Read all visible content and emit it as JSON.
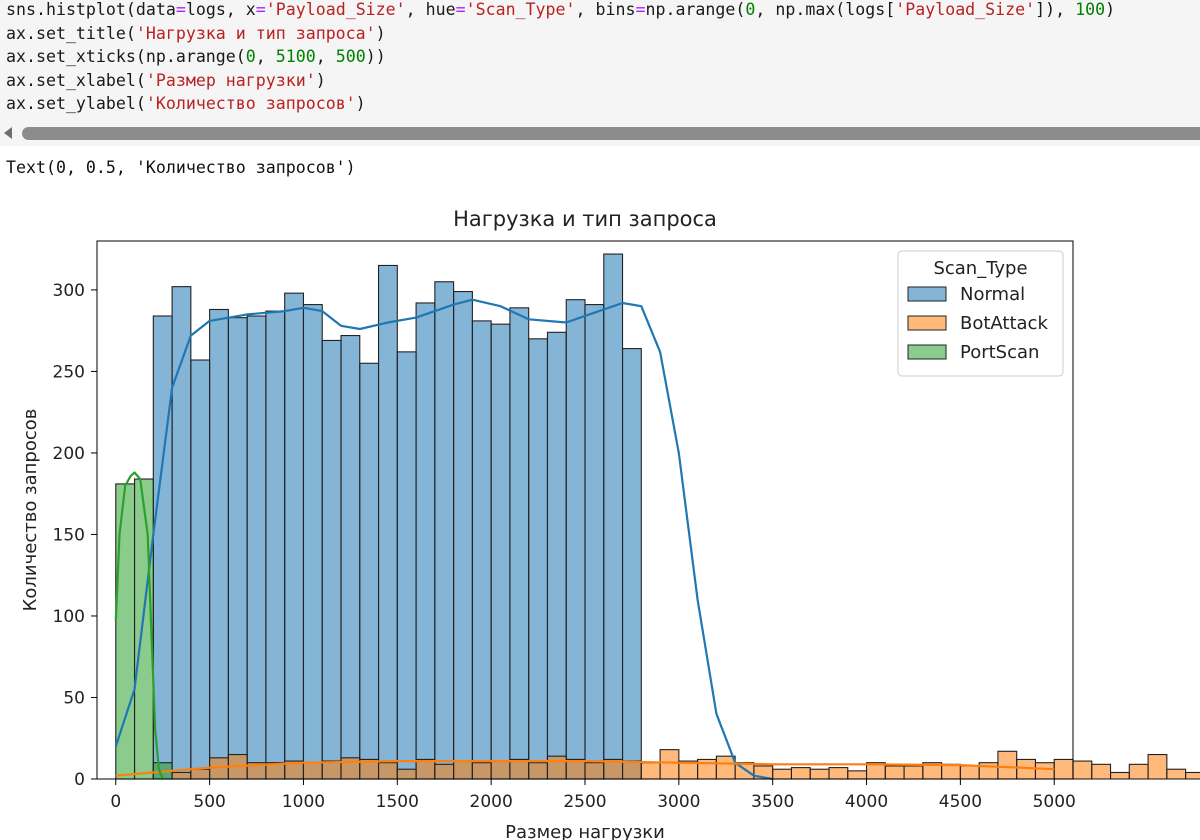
{
  "code_cell": {
    "lines": [
      [
        {
          "t": "sns.histplot(data"
        },
        {
          "t": "=",
          "c": "op"
        },
        {
          "t": "logs, x"
        },
        {
          "t": "=",
          "c": "op"
        },
        {
          "t": "'Payload_Size'",
          "c": "str"
        },
        {
          "t": ", hue"
        },
        {
          "t": "=",
          "c": "op"
        },
        {
          "t": "'Scan_Type'",
          "c": "str"
        },
        {
          "t": ", bins"
        },
        {
          "t": "=",
          "c": "op"
        },
        {
          "t": "np.arange("
        },
        {
          "t": "0",
          "c": "num"
        },
        {
          "t": ", np.max(logs["
        },
        {
          "t": "'Payload_Size'",
          "c": "str"
        },
        {
          "t": "]), "
        },
        {
          "t": "100",
          "c": "num"
        },
        {
          "t": ")"
        }
      ],
      [
        {
          "t": "ax.set_title("
        },
        {
          "t": "'Нагрузка и тип запроса'",
          "c": "str"
        },
        {
          "t": ")"
        }
      ],
      [
        {
          "t": "ax.set_xticks(np.arange("
        },
        {
          "t": "0",
          "c": "num"
        },
        {
          "t": ", "
        },
        {
          "t": "5100",
          "c": "num"
        },
        {
          "t": ", "
        },
        {
          "t": "500",
          "c": "num"
        },
        {
          "t": "))"
        }
      ],
      [
        {
          "t": "ax.set_xlabel("
        },
        {
          "t": "'Размер нагрузки'",
          "c": "str"
        },
        {
          "t": ")"
        }
      ],
      [
        {
          "t": "ax.set_ylabel("
        },
        {
          "t": "'Количество запросов'",
          "c": "str"
        },
        {
          "t": ")"
        }
      ]
    ]
  },
  "output": {
    "text": "Text(0, 0.5, 'Количество запросов')"
  },
  "chart_data": {
    "type": "bar",
    "title": "Нагрузка и тип запроса",
    "xlabel": "Размер нагрузки",
    "ylabel": "Количество запросов",
    "xlim": [
      -100,
      5100
    ],
    "ylim": [
      0,
      330
    ],
    "xticks": [
      0,
      500,
      1000,
      1500,
      2000,
      2500,
      3000,
      3500,
      4000,
      4500,
      5000
    ],
    "yticks": [
      0,
      50,
      100,
      150,
      200,
      250,
      300
    ],
    "bin_width": 100,
    "grid": false,
    "legend": {
      "title": "Scan_Type",
      "position": "top-right"
    },
    "series": [
      {
        "name": "Normal",
        "color": "#1f77b4",
        "bins_start": 200,
        "counts": [
          284,
          302,
          257,
          288,
          283,
          284,
          287,
          298,
          291,
          269,
          272,
          255,
          315,
          262,
          292,
          305,
          299,
          281,
          279,
          289,
          270,
          274,
          294,
          291,
          322,
          264
        ],
        "kde": [
          [
            0,
            20
          ],
          [
            100,
            55
          ],
          [
            200,
            150
          ],
          [
            300,
            240
          ],
          [
            400,
            272
          ],
          [
            500,
            281
          ],
          [
            700,
            285
          ],
          [
            900,
            287
          ],
          [
            1000,
            289
          ],
          [
            1100,
            287
          ],
          [
            1200,
            278
          ],
          [
            1300,
            276
          ],
          [
            1450,
            280
          ],
          [
            1600,
            283
          ],
          [
            1800,
            291
          ],
          [
            1900,
            294
          ],
          [
            2050,
            290
          ],
          [
            2200,
            282
          ],
          [
            2400,
            280
          ],
          [
            2550,
            286
          ],
          [
            2700,
            292
          ],
          [
            2800,
            290
          ],
          [
            2900,
            262
          ],
          [
            3000,
            200
          ],
          [
            3100,
            110
          ],
          [
            3200,
            40
          ],
          [
            3300,
            10
          ],
          [
            3400,
            2
          ],
          [
            3500,
            0
          ]
        ]
      },
      {
        "name": "BotAttack",
        "color": "#ff7f0e",
        "bins_start": 300,
        "counts": [
          4,
          6,
          13,
          15,
          10,
          10,
          11,
          10,
          11,
          13,
          12,
          10,
          6,
          12,
          9,
          11,
          10,
          11,
          12,
          10,
          14,
          12,
          10,
          12,
          11,
          10,
          18,
          11,
          12,
          14,
          10,
          8,
          6,
          7,
          6,
          7,
          5,
          10,
          8,
          8,
          10,
          9,
          8,
          10,
          17,
          12,
          10,
          12,
          11,
          9,
          4,
          9,
          15,
          6,
          4
        ],
        "kde": [
          [
            0,
            2
          ],
          [
            500,
            7
          ],
          [
            1000,
            10
          ],
          [
            1500,
            11
          ],
          [
            2000,
            11
          ],
          [
            2500,
            11
          ],
          [
            3000,
            10
          ],
          [
            3500,
            9
          ],
          [
            4000,
            9
          ],
          [
            4500,
            8.5
          ],
          [
            5000,
            6
          ]
        ]
      },
      {
        "name": "PortScan",
        "color": "#2ca02c",
        "bins_start": 0,
        "counts": [
          181,
          184,
          10
        ],
        "kde": [
          [
            0,
            97
          ],
          [
            20,
            150
          ],
          [
            50,
            180
          ],
          [
            80,
            186
          ],
          [
            100,
            188
          ],
          [
            130,
            184
          ],
          [
            170,
            150
          ],
          [
            190,
            90
          ],
          [
            210,
            30
          ],
          [
            230,
            6
          ],
          [
            250,
            0
          ]
        ]
      }
    ]
  }
}
